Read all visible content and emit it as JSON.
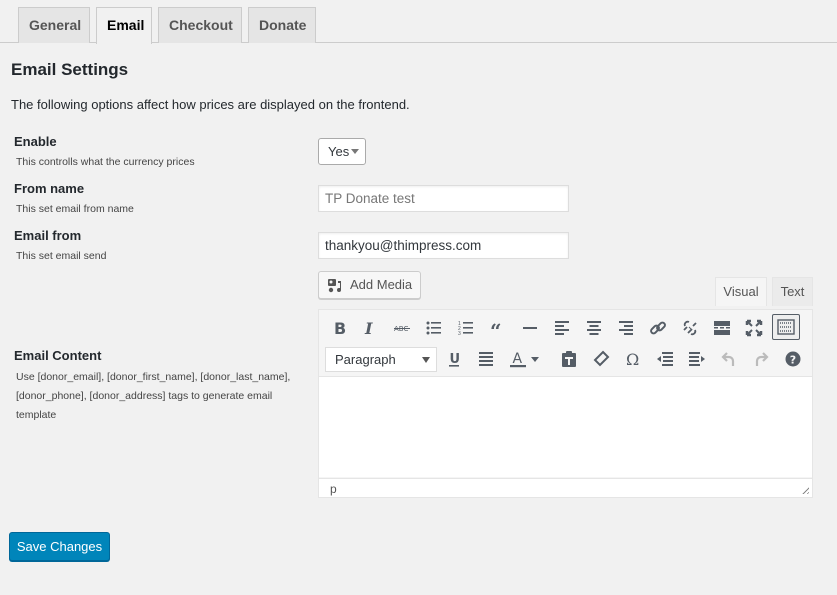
{
  "tabs": [
    {
      "label": "General",
      "active": false
    },
    {
      "label": "Email",
      "active": true
    },
    {
      "label": "Checkout",
      "active": false
    },
    {
      "label": "Donate",
      "active": false
    }
  ],
  "page": {
    "title": "Email Settings",
    "intro": "The following options affect how prices are displayed on the frontend."
  },
  "fields": {
    "enable": {
      "label": "Enable",
      "description": "This controlls what the currency prices",
      "value": "Yes"
    },
    "from_name": {
      "label": "From name",
      "description": "This set email from name",
      "placeholder": "TP Donate test",
      "value": ""
    },
    "email_from": {
      "label": "Email from",
      "description": "This set email send",
      "value": "thankyou@thimpress.com"
    },
    "email_content": {
      "label": "Email Content",
      "description_lines": [
        "Use [donor_email], [donor_first_name], [donor_last_name],",
        "[donor_phone], [donor_address] tags to generate email",
        "template"
      ]
    }
  },
  "editor": {
    "add_media_label": "Add Media",
    "visual_tab": "Visual",
    "text_tab": "Text",
    "format_select": "Paragraph",
    "statusbar_path": "p",
    "toolbar_row1": [
      "bold",
      "italic",
      "strikethrough",
      "bullet-list",
      "numbered-list",
      "blockquote",
      "horizontal-line",
      "align-left",
      "align-center",
      "align-right",
      "insert-link",
      "remove-link",
      "read-more",
      "fullscreen",
      "toolbar-toggle"
    ],
    "toolbar_row2": [
      "underline",
      "justify",
      "text-color",
      "paste-as-text",
      "clear-formatting",
      "special-character",
      "decrease-indent",
      "increase-indent",
      "undo",
      "redo",
      "keyboard-shortcuts"
    ]
  },
  "actions": {
    "save_label": "Save Changes"
  },
  "colors": {
    "primary_button": "#0085ba",
    "background": "#f1f1f1"
  }
}
